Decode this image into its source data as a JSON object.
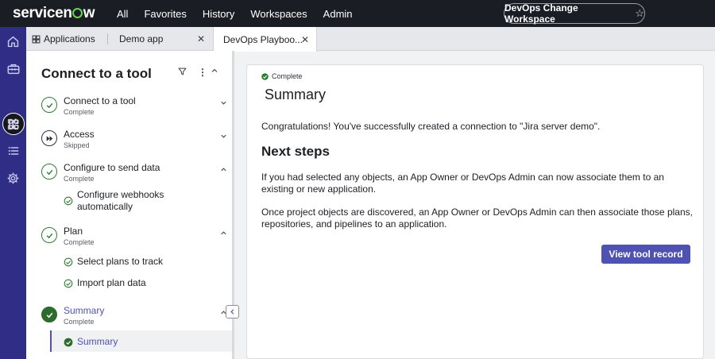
{
  "app": {
    "logo_text": "servicenow",
    "nav": [
      "All",
      "Favorites",
      "History",
      "Workspaces",
      "Admin"
    ],
    "workspace_name": "DevOps Change Workspace"
  },
  "tabs": [
    {
      "label": "Applications",
      "closable": false,
      "active": false
    },
    {
      "label": "Demo app",
      "closable": true,
      "active": false
    },
    {
      "label": "DevOps Playboo...",
      "closable": true,
      "active": true
    }
  ],
  "panel": {
    "title": "Connect to a tool",
    "steps": [
      {
        "label": "Connect to a tool",
        "status": "Complete",
        "state": "complete",
        "chevron": "down"
      },
      {
        "label": "Access",
        "status": "Skipped",
        "state": "skipped",
        "chevron": "down"
      },
      {
        "label": "Configure to send data",
        "status": "Complete",
        "state": "complete",
        "chevron": "up",
        "children": [
          "Configure webhooks automatically"
        ]
      },
      {
        "label": "Plan",
        "status": "Complete",
        "state": "complete",
        "chevron": "up",
        "children": [
          "Select plans to track",
          "Import plan data"
        ]
      },
      {
        "label": "Summary",
        "status": "Complete",
        "state": "current",
        "chevron": "up",
        "children": [
          "Summary"
        ]
      }
    ]
  },
  "content": {
    "status": "Complete",
    "title": "Summary",
    "congrats": "Congratulations! You've successfully created a connection to \"Jira server demo\".",
    "next_steps_heading": "Next steps",
    "para1": "If you had selected any objects, an App Owner or DevOps Admin can now associate them to an existing or new application.",
    "para2": "Once project objects are discovered, an App Owner or DevOps Admin can then associate those plans, repositories, and pipelines to an application.",
    "button_label": "View tool record"
  },
  "colors": {
    "topbar": "#1a1d24",
    "rail": "#2f2d86",
    "accent": "#4f52b2",
    "success": "#2e7d32"
  }
}
